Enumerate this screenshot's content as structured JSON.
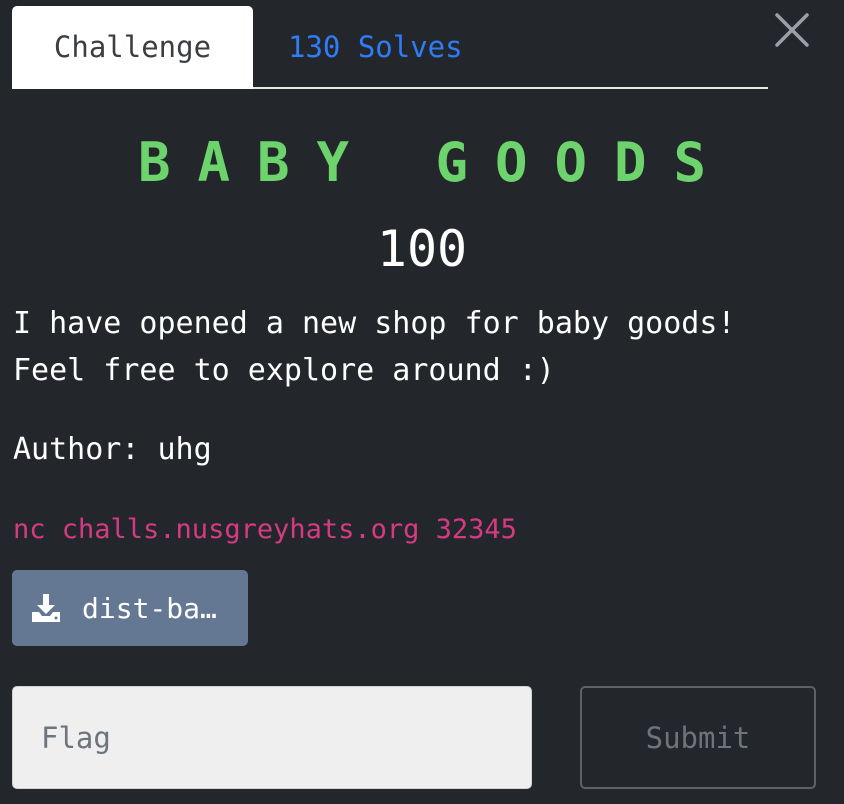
{
  "tabs": {
    "challenge": "Challenge",
    "solves": "130 Solves"
  },
  "challenge": {
    "name": "BABY GOODS",
    "value": "100",
    "description": [
      "I have opened a new shop for baby goods!",
      "Feel free to explore around :)"
    ],
    "author": "Author: uhg",
    "connection": "nc challs.nusgreyhats.org 32345",
    "file_label": "dist-ba…"
  },
  "form": {
    "flag_placeholder": "Flag",
    "flag_value": "",
    "submit_label": "Submit"
  },
  "icons": {
    "close": "close-icon",
    "download": "download-icon"
  },
  "colors": {
    "background": "#23272b",
    "title": "#6dd36c",
    "solves_link": "#2f7cf6",
    "connection_text": "#d63a83",
    "file_button": "#647793"
  }
}
